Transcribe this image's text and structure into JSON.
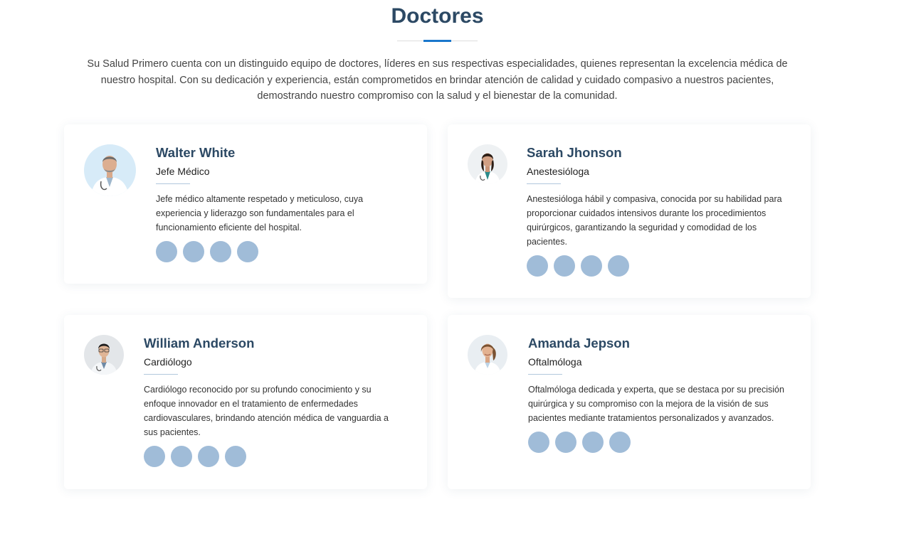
{
  "section": {
    "title": "Doctores",
    "description": "Su Salud Primero cuenta con un distinguido equipo de doctores, líderes en sus respectivas especialidades, quienes representan la excelencia médica de nuestro hospital. Con su dedicación y experiencia, están comprometidos en brindar atención de calidad y cuidado compasivo a nuestros pacientes, demostrando nuestro compromiso con la salud y el bienestar de la comunidad."
  },
  "doctors": [
    {
      "name": "Walter White",
      "role": "Jefe Médico",
      "description": "Jefe médico altamente respetado y meticuloso, cuya experiencia y liderazgo son fundamentales para el funcionamiento eficiente del hospital."
    },
    {
      "name": "Sarah Jhonson",
      "role": "Anestesióloga",
      "description": "Anestesióloga hábil y compasiva, conocida por su habilidad para proporcionar cuidados intensivos durante los procedimientos quirúrgicos, garantizando la seguridad y comodidad de los pacientes."
    },
    {
      "name": "William Anderson",
      "role": "Cardiólogo",
      "description": "Cardiólogo reconocido por su profundo conocimiento y su enfoque innovador en el tratamiento de enfermedades cardiovasculares, brindando atención médica de vanguardia a sus pacientes."
    },
    {
      "name": "Amanda Jepson",
      "role": "Oftalmóloga",
      "description": "Oftalmóloga dedicada y experta, que se destaca por su precisión quirúrgica y su compromiso con la mejora de la visión de sus pacientes mediante tratamientos personalizados y avanzados."
    }
  ],
  "social_icons": [
    "twitter-icon",
    "facebook-icon",
    "instagram-icon",
    "linkedin-icon"
  ],
  "colors": {
    "heading": "#2c4964",
    "accent": "#1977cc",
    "social": "#a0bcd8"
  }
}
